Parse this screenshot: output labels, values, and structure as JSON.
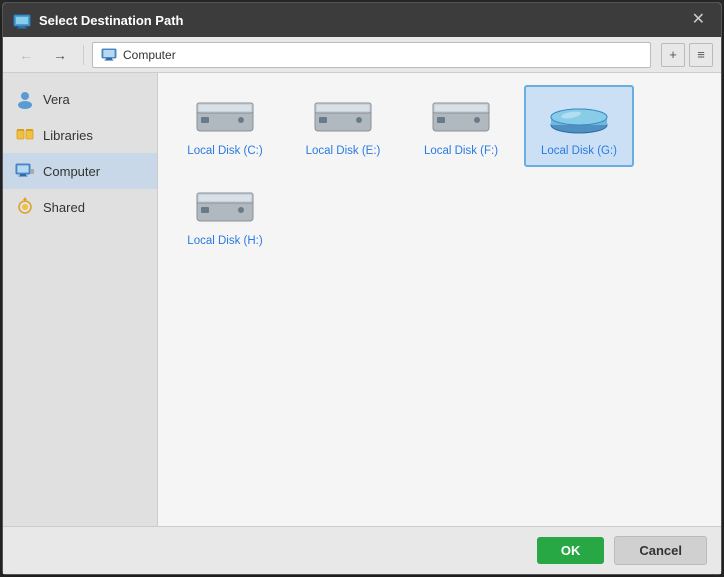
{
  "dialog": {
    "title": "Select Destination Path",
    "icon": "destination-icon"
  },
  "toolbar": {
    "back_label": "←",
    "forward_label": "→",
    "address": "Computer",
    "new_folder_label": "+",
    "view_label": "≡"
  },
  "sidebar": {
    "items": [
      {
        "id": "vera",
        "label": "Vera",
        "icon": "user-icon"
      },
      {
        "id": "libraries",
        "label": "Libraries",
        "icon": "libraries-icon"
      },
      {
        "id": "computer",
        "label": "Computer",
        "icon": "computer-icon",
        "active": true
      },
      {
        "id": "shared",
        "label": "Shared",
        "icon": "shared-icon"
      }
    ]
  },
  "files": [
    {
      "id": "disk-c",
      "label": "Local Disk (C:)",
      "selected": false
    },
    {
      "id": "disk-e",
      "label": "Local Disk (E:)",
      "selected": false
    },
    {
      "id": "disk-f",
      "label": "Local Disk (F:)",
      "selected": false
    },
    {
      "id": "disk-g",
      "label": "Local Disk (G:)",
      "selected": true
    },
    {
      "id": "disk-h",
      "label": "Local Disk (H:)",
      "selected": false
    }
  ],
  "footer": {
    "ok_label": "OK",
    "cancel_label": "Cancel"
  }
}
